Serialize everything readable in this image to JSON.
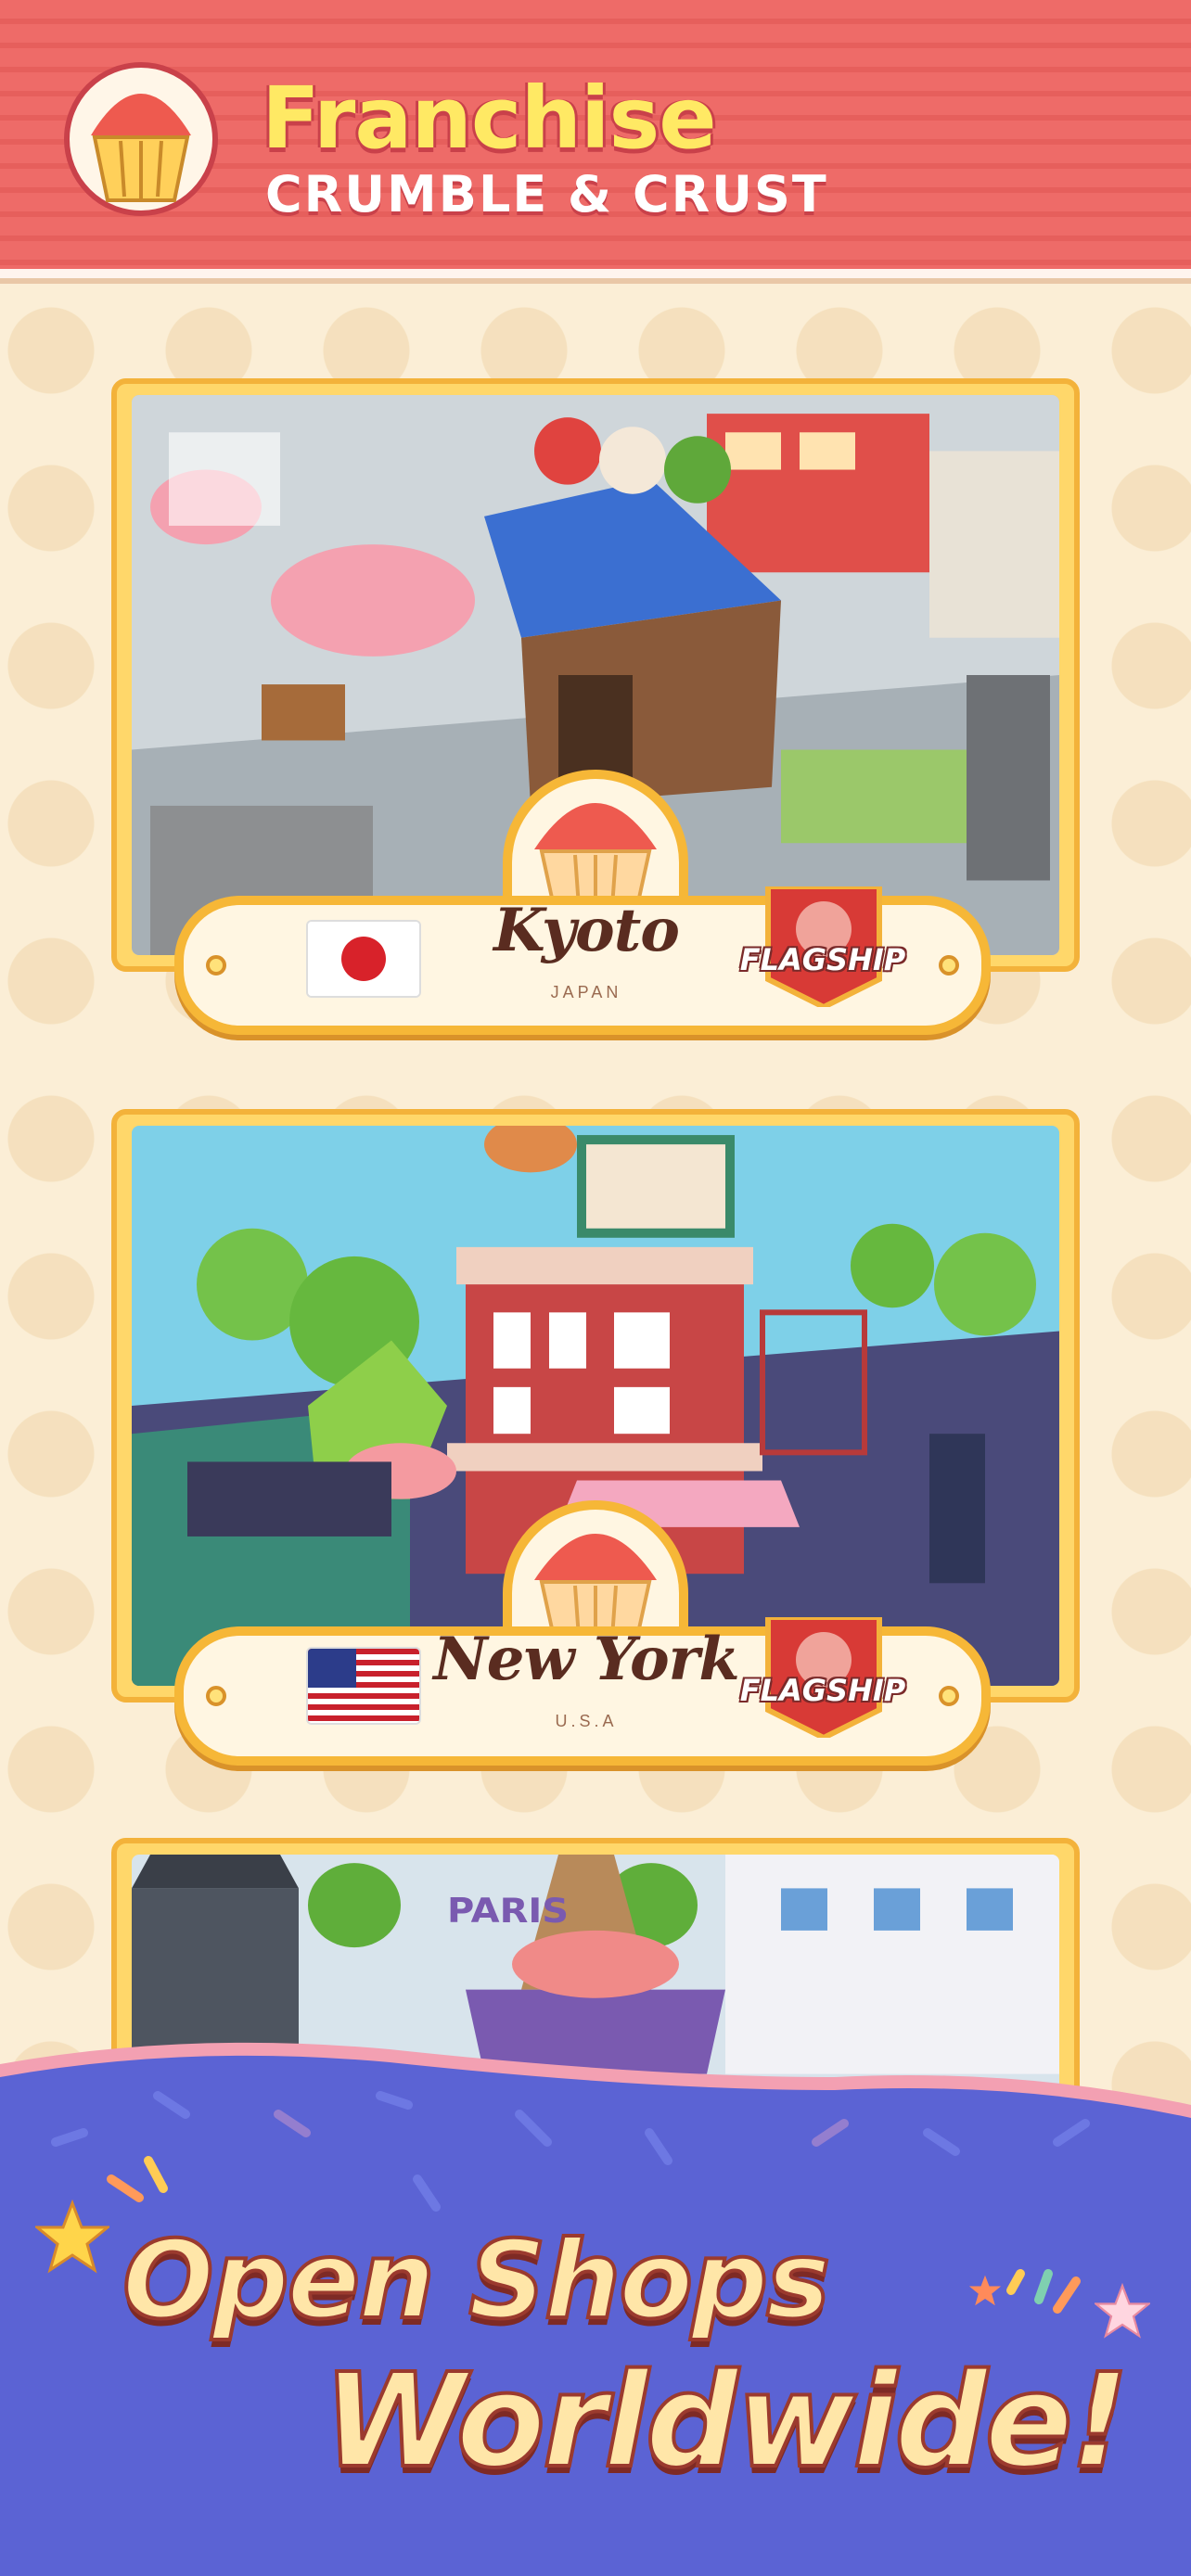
{
  "header": {
    "title": "Franchise",
    "subtitle": "CRUMBLE & CRUST",
    "logo_icon": "muffin-icon"
  },
  "cards": [
    {
      "city": "Kyoto",
      "country": "JAPAN",
      "flag_icon": "japan-flag-icon",
      "badge": "FLAGSHIP"
    },
    {
      "city": "New York",
      "country": "U.S.A",
      "flag_icon": "usa-flag-icon",
      "badge": "FLAGSHIP"
    },
    {
      "scene_sign": "PARIS"
    }
  ],
  "promo": {
    "line1": "Open Shops",
    "line2": "Worldwide!"
  },
  "colors": {
    "header_red": "#ee6b68",
    "title_yellow": "#ffe964",
    "card_gold": "#f6b737",
    "panel_blue": "#5b63d4",
    "background": "#fbeed6"
  }
}
